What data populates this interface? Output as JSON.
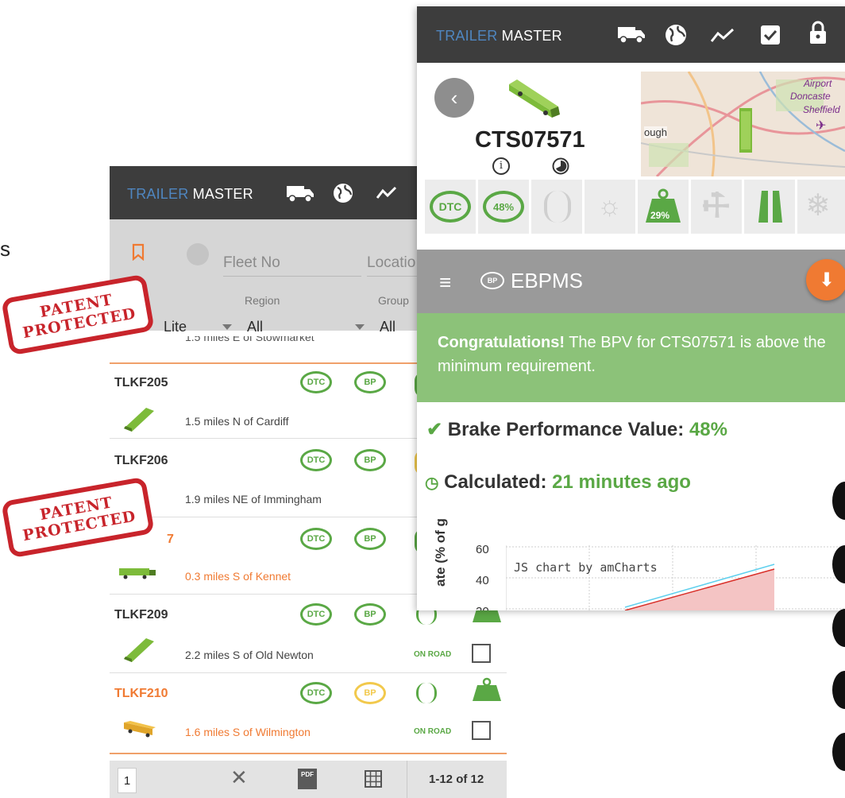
{
  "list_screen": {
    "brand": {
      "part1": "TRAILER",
      "part2": "MASTER"
    },
    "search": {
      "fleet_placeholder": "Fleet No",
      "location_placeholder": "Locatio"
    },
    "filters": {
      "col1_value": "Lite",
      "region_label": "Region",
      "region_value": "All",
      "group_label": "Group",
      "group_value": "All"
    },
    "cut_text": "1.5 miles E of Stowmarket",
    "rows": [
      {
        "id": "TLKF205",
        "location": "1.5 miles N of Cardiff"
      },
      {
        "id": "TLKF206",
        "location": "1.9 miles NE of Immingham"
      },
      {
        "id": "7",
        "location": "0.3 miles S of Kennet"
      },
      {
        "id": "TLKF209",
        "location": "2.2 miles S of Old Newton",
        "status": "ON ROAD"
      },
      {
        "id": "TLKF210",
        "location": "1.6 miles S of Wilmington",
        "status": "ON ROAD"
      }
    ],
    "badges": {
      "dtc": "DTC",
      "bp": "BP"
    },
    "footer": {
      "page": "1",
      "count": "1-12 of 12",
      "pdf": "PDF"
    }
  },
  "detail_screen": {
    "brand": {
      "part1": "TRAILER",
      "part2": "MASTER"
    },
    "trailer_id": "CTS07571",
    "map_labels": {
      "airport": "Airport",
      "doncaster": "Doncaste",
      "sheffield": "Sheffield",
      "ough": "ough"
    },
    "tiles": {
      "dtc": "DTC",
      "bp_percent": "48%",
      "load_percent": "29%"
    },
    "section_title": "EBPMS",
    "section_icon_label": "BP",
    "congrats": {
      "bold": "Congratulations!",
      "rest": "The BPV for CTS07571 is above the minimum requirement."
    },
    "bpv": {
      "label": "Brake Performance Value:",
      "value": "48%"
    },
    "calculated": {
      "label": "Calculated:",
      "value": "21 minutes ago"
    },
    "chart": {
      "ylabel": "ate (% of g",
      "credit": "JS chart by amCharts",
      "ticks": [
        "60",
        "40",
        "20"
      ]
    }
  },
  "stamps": {
    "line1": "PATENT",
    "line2": "PROTECTED"
  },
  "left_edge_text": "s",
  "colors": {
    "header": "#3d3d3d",
    "accent_green": "#5aa845",
    "accent_orange": "#f07a32",
    "brand_blue": "#4f86c0",
    "congrats_bg": "#8cc279"
  }
}
